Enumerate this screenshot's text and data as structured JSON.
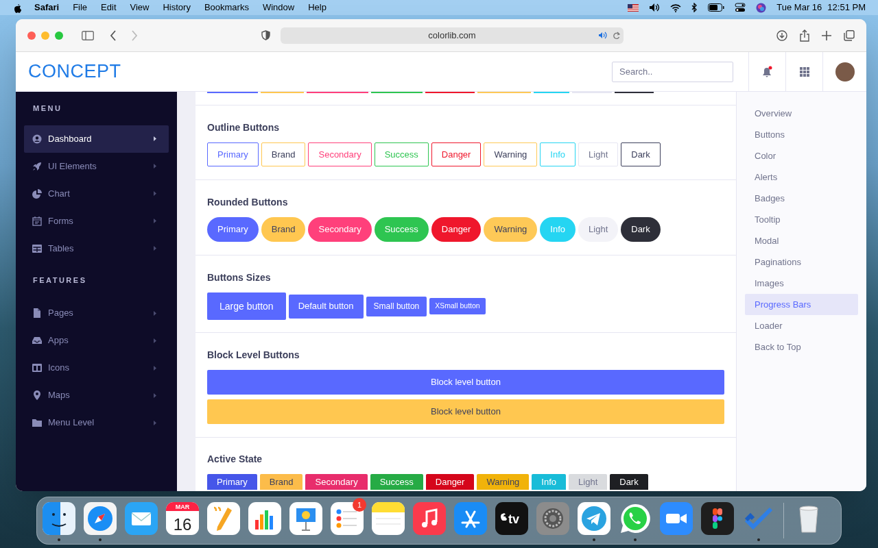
{
  "menu_bar": {
    "app": "Safari",
    "items": [
      "File",
      "Edit",
      "View",
      "History",
      "Bookmarks",
      "Window",
      "Help"
    ],
    "date": "Tue Mar 16",
    "time": "12:51 PM"
  },
  "browser": {
    "address": "colorlib.com"
  },
  "header": {
    "logo": "CONCEPT",
    "search": {
      "placeholder": "Search.."
    }
  },
  "sidebar": {
    "groups": [
      {
        "title": "MENU",
        "items": [
          {
            "label": "Dashboard",
            "selected": true
          },
          {
            "label": "UI Elements",
            "selected": false
          },
          {
            "label": "Chart",
            "selected": false
          },
          {
            "label": "Forms",
            "selected": false
          },
          {
            "label": "Tables",
            "selected": false
          }
        ]
      },
      {
        "title": "FEATURES",
        "items": [
          {
            "label": "Pages",
            "selected": false
          },
          {
            "label": "Apps",
            "selected": false
          },
          {
            "label": "Icons",
            "selected": false
          },
          {
            "label": "Maps",
            "selected": false
          },
          {
            "label": "Menu Level",
            "selected": false
          }
        ]
      }
    ]
  },
  "sections": [
    {
      "title": "Outline Buttons",
      "kind": "outline",
      "buttons": [
        "Primary",
        "Brand",
        "Secondary",
        "Success",
        "Danger",
        "Warning",
        "Info",
        "Light",
        "Dark"
      ]
    },
    {
      "title": "Rounded Buttons",
      "kind": "rounded",
      "buttons": [
        "Primary",
        "Brand",
        "Secondary",
        "Success",
        "Danger",
        "Warning",
        "Info",
        "Light",
        "Dark"
      ]
    },
    {
      "title": "Buttons Sizes",
      "kind": "sizes",
      "buttons": [
        "Large button",
        "Default button",
        "Small button",
        "XSmall button"
      ]
    },
    {
      "title": "Block Level Buttons",
      "kind": "block",
      "buttons": [
        "Block level button",
        "Block level button"
      ]
    },
    {
      "title": "Active State",
      "kind": "active",
      "buttons": [
        "Primary",
        "Brand",
        "Secondary",
        "Success",
        "Danger",
        "Warning",
        "Info",
        "Light",
        "Dark"
      ]
    }
  ],
  "page_nav": [
    {
      "label": "Overview",
      "selected": false
    },
    {
      "label": "Buttons",
      "selected": false
    },
    {
      "label": "Color",
      "selected": false
    },
    {
      "label": "Alerts",
      "selected": false
    },
    {
      "label": "Badges",
      "selected": false
    },
    {
      "label": "Tooltip",
      "selected": false
    },
    {
      "label": "Modal",
      "selected": false
    },
    {
      "label": "Paginations",
      "selected": false
    },
    {
      "label": "Images",
      "selected": false
    },
    {
      "label": "Progress Bars",
      "selected": true
    },
    {
      "label": "Loader",
      "selected": false
    },
    {
      "label": "Back to Top",
      "selected": false
    }
  ],
  "dock": [
    {
      "running": true
    },
    {
      "running": true
    },
    {
      "running": false
    },
    {
      "running": false,
      "month": "MAR",
      "day": "16"
    },
    {
      "running": false
    },
    {
      "running": false
    },
    {
      "running": false
    },
    {
      "running": false,
      "badge": "1"
    },
    {
      "running": false
    },
    {
      "running": false
    },
    {
      "running": false
    },
    {
      "running": false,
      "text": "tv"
    },
    {
      "running": false
    },
    {
      "running": true
    },
    {
      "running": true
    },
    {
      "running": false
    },
    {
      "running": false
    },
    {
      "running": true
    },
    {
      "running": false
    }
  ]
}
